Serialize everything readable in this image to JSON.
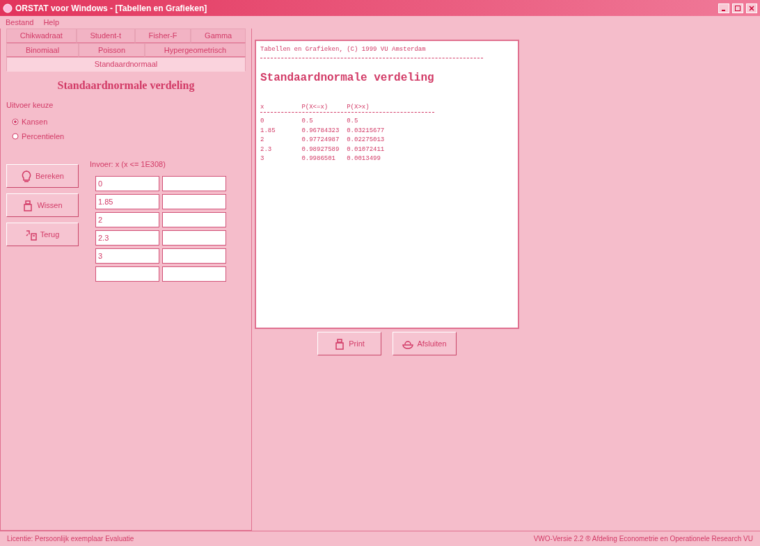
{
  "window": {
    "title": "ORSTAT voor Windows - [Tabellen en Grafieken]"
  },
  "menu": [
    "Bestand",
    "Help"
  ],
  "tab_rows": [
    [
      {
        "label": "Chikwadraat",
        "selected": false
      },
      {
        "label": "Student-t",
        "selected": false
      },
      {
        "label": "Fisher-F",
        "selected": false
      },
      {
        "label": "Gamma",
        "selected": false
      }
    ],
    [
      {
        "label": "Binomiaal",
        "selected": false
      },
      {
        "label": "Poisson",
        "selected": false
      },
      {
        "label": "Hypergeometrisch",
        "selected": false
      }
    ],
    [
      {
        "label": "Standaardnormaal",
        "selected": true
      }
    ]
  ],
  "panel": {
    "heading": "Standaardnormale verdeling",
    "choice_label": "Uitvoer keuze",
    "options": [
      {
        "label": "Kansen",
        "selected": true
      },
      {
        "label": "Percentielen",
        "selected": false
      }
    ],
    "buttons": [
      {
        "kind": "bulb",
        "label": "Bereken"
      },
      {
        "kind": "eraser",
        "label": "Wissen"
      },
      {
        "kind": "back",
        "label": "Terug"
      }
    ],
    "input_label": "Invoer: x (x <= 1E308)",
    "inputs": [
      {
        "value": "0"
      },
      {
        "value": "1.85"
      },
      {
        "value": "2"
      },
      {
        "value": "2.3"
      },
      {
        "value": "3"
      }
    ],
    "blank_input_row": true
  },
  "output": {
    "header": "Tabellen en Grafieken, (C) 1999 VU Amsterdam",
    "title": "Standaardnormale verdeling",
    "columns": [
      "x",
      "P(X<=x)",
      "P(X>x)"
    ],
    "rows": [
      [
        "0",
        "0.5",
        "0.5"
      ],
      [
        "1.85",
        "0.96784323",
        "0.03215677"
      ],
      [
        "2",
        "0.97724987",
        "0.02275013"
      ],
      [
        "2.3",
        "0.98927589",
        "0.01072411"
      ],
      [
        "3",
        "0.9986501",
        "0.0013499"
      ]
    ],
    "buttons": [
      {
        "kind": "print",
        "label": "Print"
      },
      {
        "kind": "close",
        "label": "Afsluiten"
      }
    ]
  },
  "status_bar": {
    "left": "Licentie: Persoonlijk exemplaar Evaluatie",
    "right": "VWO-Versie 2.2 ® Afdeling Econometrie en Operationele Research VU"
  }
}
